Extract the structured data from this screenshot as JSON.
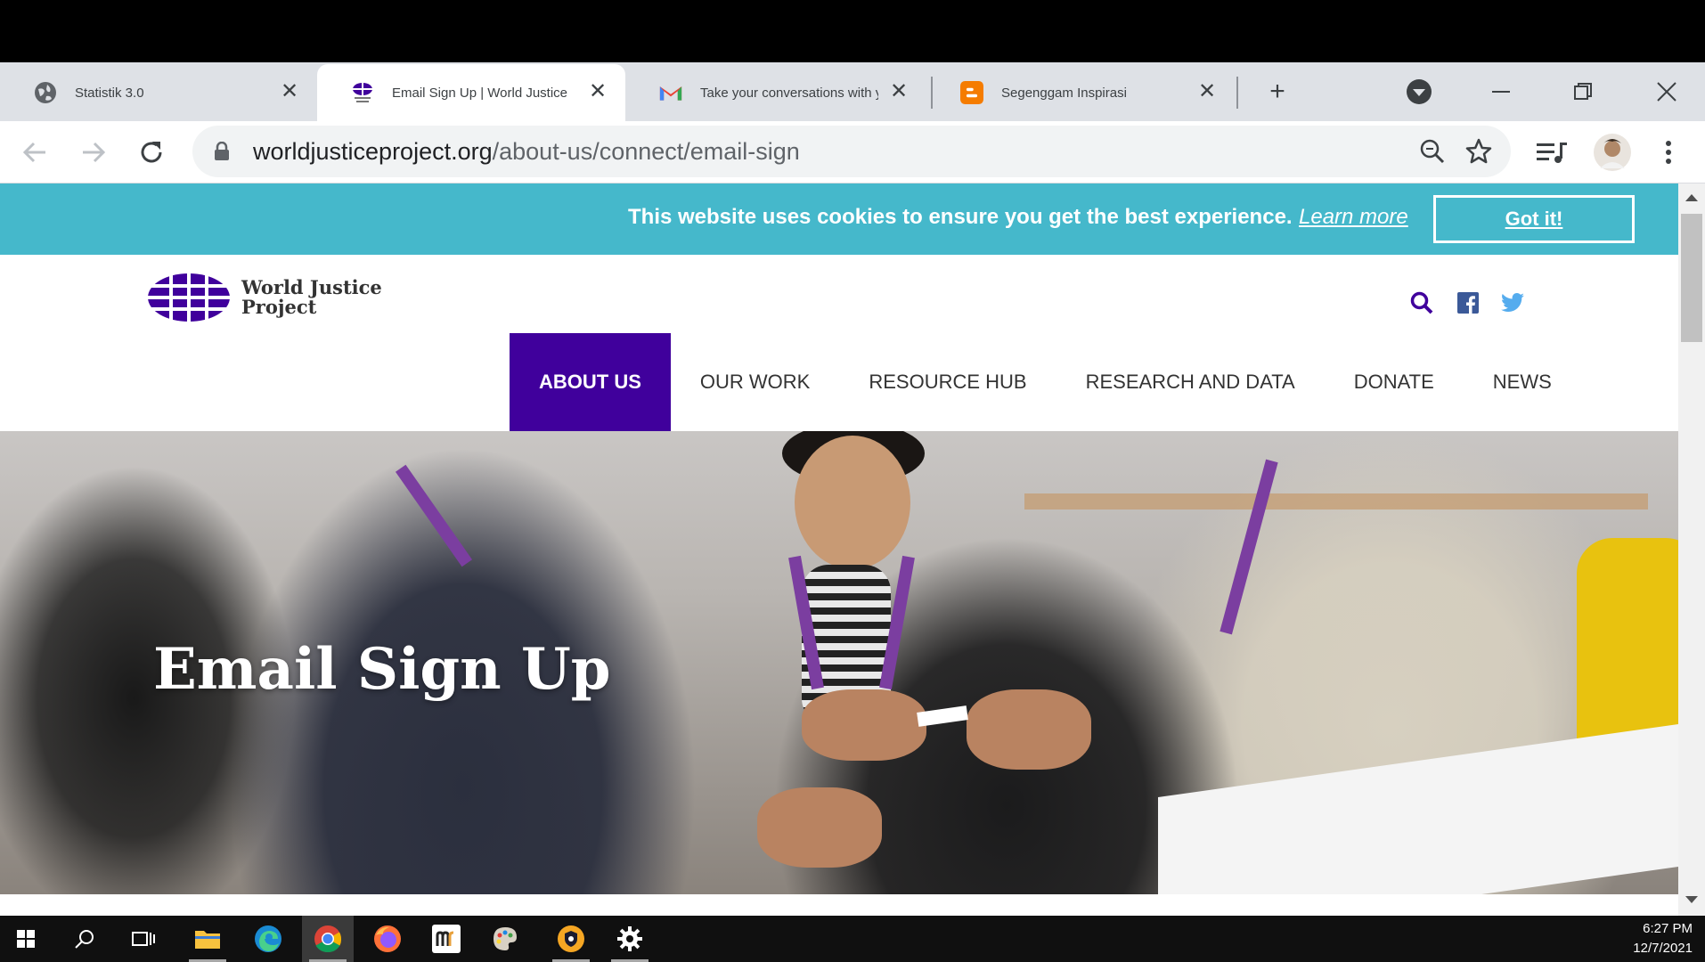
{
  "browser": {
    "tabs": [
      {
        "title": "Statistik 3.0",
        "favicon": "globe-icon",
        "active": false
      },
      {
        "title": "Email Sign Up | World Justice Project",
        "favicon": "wjp-icon",
        "active": true
      },
      {
        "title": "Take your conversations with you",
        "favicon": "gmail-icon",
        "active": false
      },
      {
        "title": "Segenggam Inspirasi",
        "favicon": "blogger-icon",
        "active": false
      }
    ],
    "url_host": "worldjusticeproject.org",
    "url_path": "/about-us/connect/email-sign"
  },
  "cookie_banner": {
    "message": "This website uses cookies to ensure you get the best experience.",
    "link": "Learn more",
    "button": "Got it!",
    "color": "#45b8cb"
  },
  "site": {
    "logo_line1": "World Justice",
    "logo_line2": "Project",
    "brand_color": "#40009c",
    "nav": [
      "ABOUT US",
      "OUR WORK",
      "RESOURCE HUB",
      "RESEARCH AND DATA",
      "DONATE",
      "NEWS"
    ],
    "active_nav": "ABOUT US",
    "hero_title": "Email Sign Up"
  },
  "taskbar": {
    "time": "6:27 PM",
    "date": "12/7/2021"
  }
}
